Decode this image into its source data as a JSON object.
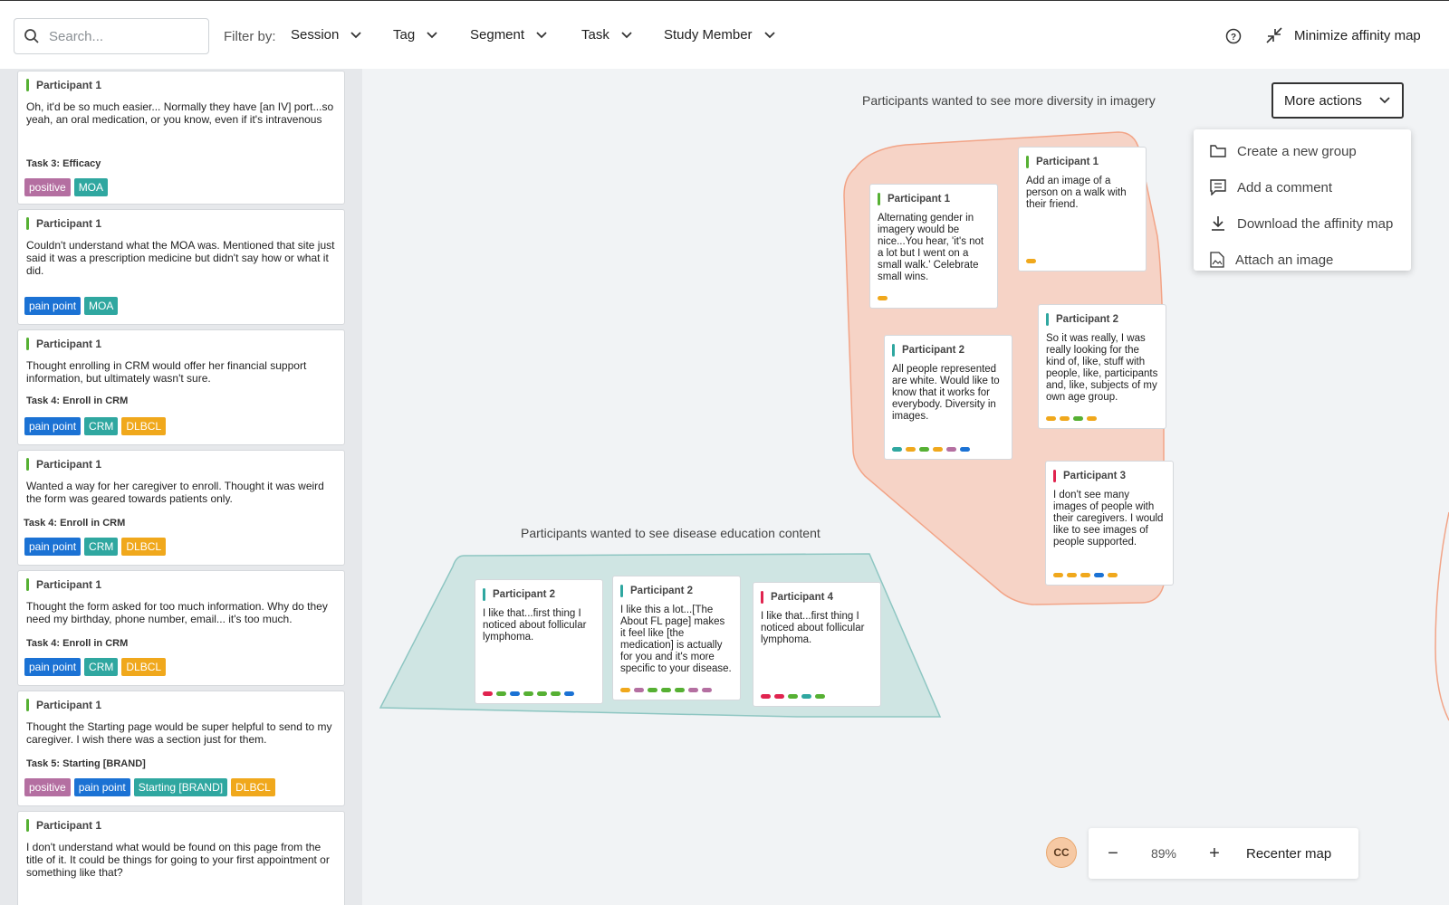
{
  "header": {
    "search_placeholder": "Search...",
    "filter_label": "Filter by:",
    "filters": [
      "Session",
      "Tag",
      "Segment",
      "Task",
      "Study Member"
    ],
    "minimize_label": "Minimize affinity map"
  },
  "sidebar": {
    "cards": [
      {
        "participant": "Participant 1",
        "quote": "Oh, it'd be so much easier... Normally they have [an IV] port...so yeah, an oral medication, or you know, even if it's intravenous",
        "task": "Task 3: Efficacy",
        "tags": [
          {
            "label": "positive",
            "color": "#b46fa1"
          },
          {
            "label": "MOA",
            "color": "#2fa7a0"
          }
        ]
      },
      {
        "participant": "Participant 1",
        "quote": "Couldn't understand what the MOA was. Mentioned that site just said it was a prescription medicine but didn't say how or what it did.",
        "task": "",
        "tags": [
          {
            "label": "pain point",
            "color": "#1b72d4"
          },
          {
            "label": "MOA",
            "color": "#2fa7a0"
          }
        ]
      },
      {
        "participant": "Participant 1",
        "quote": "Thought enrolling in CRM would offer her financial support information, but ultimately wasn't sure.",
        "task": "Task 4: Enroll in CRM",
        "tags": [
          {
            "label": "pain point",
            "color": "#1b72d4"
          },
          {
            "label": "CRM",
            "color": "#2fa7a0"
          },
          {
            "label": "DLBCL",
            "color": "#f0a81c"
          }
        ]
      },
      {
        "participant": "Participant 1",
        "quote": "Wanted a way for her caregiver to enroll. Thought it was weird the form was geared towards patients only.",
        "task": "Task 4: Enroll in CRM",
        "tags": [
          {
            "label": "pain point",
            "color": "#1b72d4"
          },
          {
            "label": "CRM",
            "color": "#2fa7a0"
          },
          {
            "label": "DLBCL",
            "color": "#f0a81c"
          }
        ]
      },
      {
        "participant": "Participant 1",
        "quote": "Thought the form asked for too much information. Why do they need my birthday, phone number, email... it's too much.",
        "task": "Task 4: Enroll in CRM",
        "tags": [
          {
            "label": "pain point",
            "color": "#1b72d4"
          },
          {
            "label": "CRM",
            "color": "#2fa7a0"
          },
          {
            "label": "DLBCL",
            "color": "#f0a81c"
          }
        ]
      },
      {
        "participant": "Participant 1",
        "quote": "Thought the Starting page would be super helpful to send to my caregiver. I wish there was a section just for them.",
        "task": "Task 5: Starting [BRAND]",
        "tags": [
          {
            "label": "positive",
            "color": "#b46fa1"
          },
          {
            "label": "pain point",
            "color": "#1b72d4"
          },
          {
            "label": "Starting [BRAND]",
            "color": "#2fa7a0"
          },
          {
            "label": "DLBCL",
            "color": "#f0a81c"
          }
        ]
      },
      {
        "participant": "Participant 1",
        "quote": "I don't understand what would be found on this page from the title of it. It could be things for going to your first appointment or something like that?",
        "task": "",
        "tags": []
      }
    ]
  },
  "map": {
    "groups": [
      {
        "title": "Participants wanted to see more diversity in imagery",
        "color": "#f6d3c6",
        "notes": [
          {
            "participant": "Participant 1",
            "bar": "#56b033",
            "quote": "Alternating gender in imagery would be nice...You hear, 'it's not a lot but I went on a small walk.' Celebrate small wins.",
            "dots": [
              "#f0a81c"
            ]
          },
          {
            "participant": "Participant 1",
            "bar": "#56b033",
            "quote": "Add an image of a person on a walk with their friend.",
            "dots": [
              "#f0a81c"
            ]
          },
          {
            "participant": "Participant 2",
            "bar": "#2fa7a0",
            "quote": "So it was really, I was really looking for the kind of, like, stuff with people, like, participants and, like, subjects of my own age group.",
            "dots": [
              "#f0a81c",
              "#f0a81c",
              "#56b033",
              "#f0a81c"
            ]
          },
          {
            "participant": "Participant 2",
            "bar": "#2fa7a0",
            "quote": "All people represented are white. Would like to know that it works for everybody. Diversity in images.",
            "dots": [
              "#2fa7a0",
              "#f0a81c",
              "#56b033",
              "#f0a81c",
              "#b46fa1",
              "#1b72d4"
            ]
          },
          {
            "participant": "Participant 3",
            "bar": "#e0244f",
            "quote": "I don't see many images of people with their caregivers. I would like to see images of people supported.",
            "dots": [
              "#f0a81c",
              "#f0a81c",
              "#f0a81c",
              "#1b72d4",
              "#f0a81c"
            ]
          }
        ]
      },
      {
        "title": "Participants wanted to see disease education content",
        "color": "#cfe5e3",
        "notes": [
          {
            "participant": "Participant 2",
            "bar": "#2fa7a0",
            "quote": "I like that...first thing I noticed about follicular lymphoma.",
            "dots": [
              "#e0244f",
              "#56b033",
              "#1b72d4",
              "#56b033",
              "#56b033",
              "#56b033",
              "#1b72d4"
            ]
          },
          {
            "participant": "Participant 2",
            "bar": "#2fa7a0",
            "quote": "I like this a lot...[The About FL page] makes it feel like [the medication] is actually for you and it's more specific to your disease.",
            "dots": [
              "#f0a81c",
              "#b46fa1",
              "#56b033",
              "#56b033",
              "#56b033",
              "#b46fa1",
              "#b46fa1"
            ]
          },
          {
            "participant": "Participant 4",
            "bar": "#e0244f",
            "quote": "I like that...first thing I noticed about follicular lymphoma.",
            "dots": [
              "#e0244f",
              "#e0244f",
              "#56b033",
              "#2fa7a0",
              "#56b033"
            ]
          }
        ]
      }
    ],
    "more_actions": {
      "label": "More actions",
      "items": [
        {
          "label": "Create a new group",
          "icon": "folder-icon"
        },
        {
          "label": "Add a comment",
          "icon": "comment-icon"
        },
        {
          "label": "Download the affinity map",
          "icon": "download-icon"
        },
        {
          "label": "Attach an image",
          "icon": "image-file-icon"
        }
      ]
    }
  },
  "footer": {
    "avatar_initials": "CC",
    "zoom": "89%",
    "zoom_out": "−",
    "zoom_in": "+",
    "recenter_label": "Recenter map"
  }
}
